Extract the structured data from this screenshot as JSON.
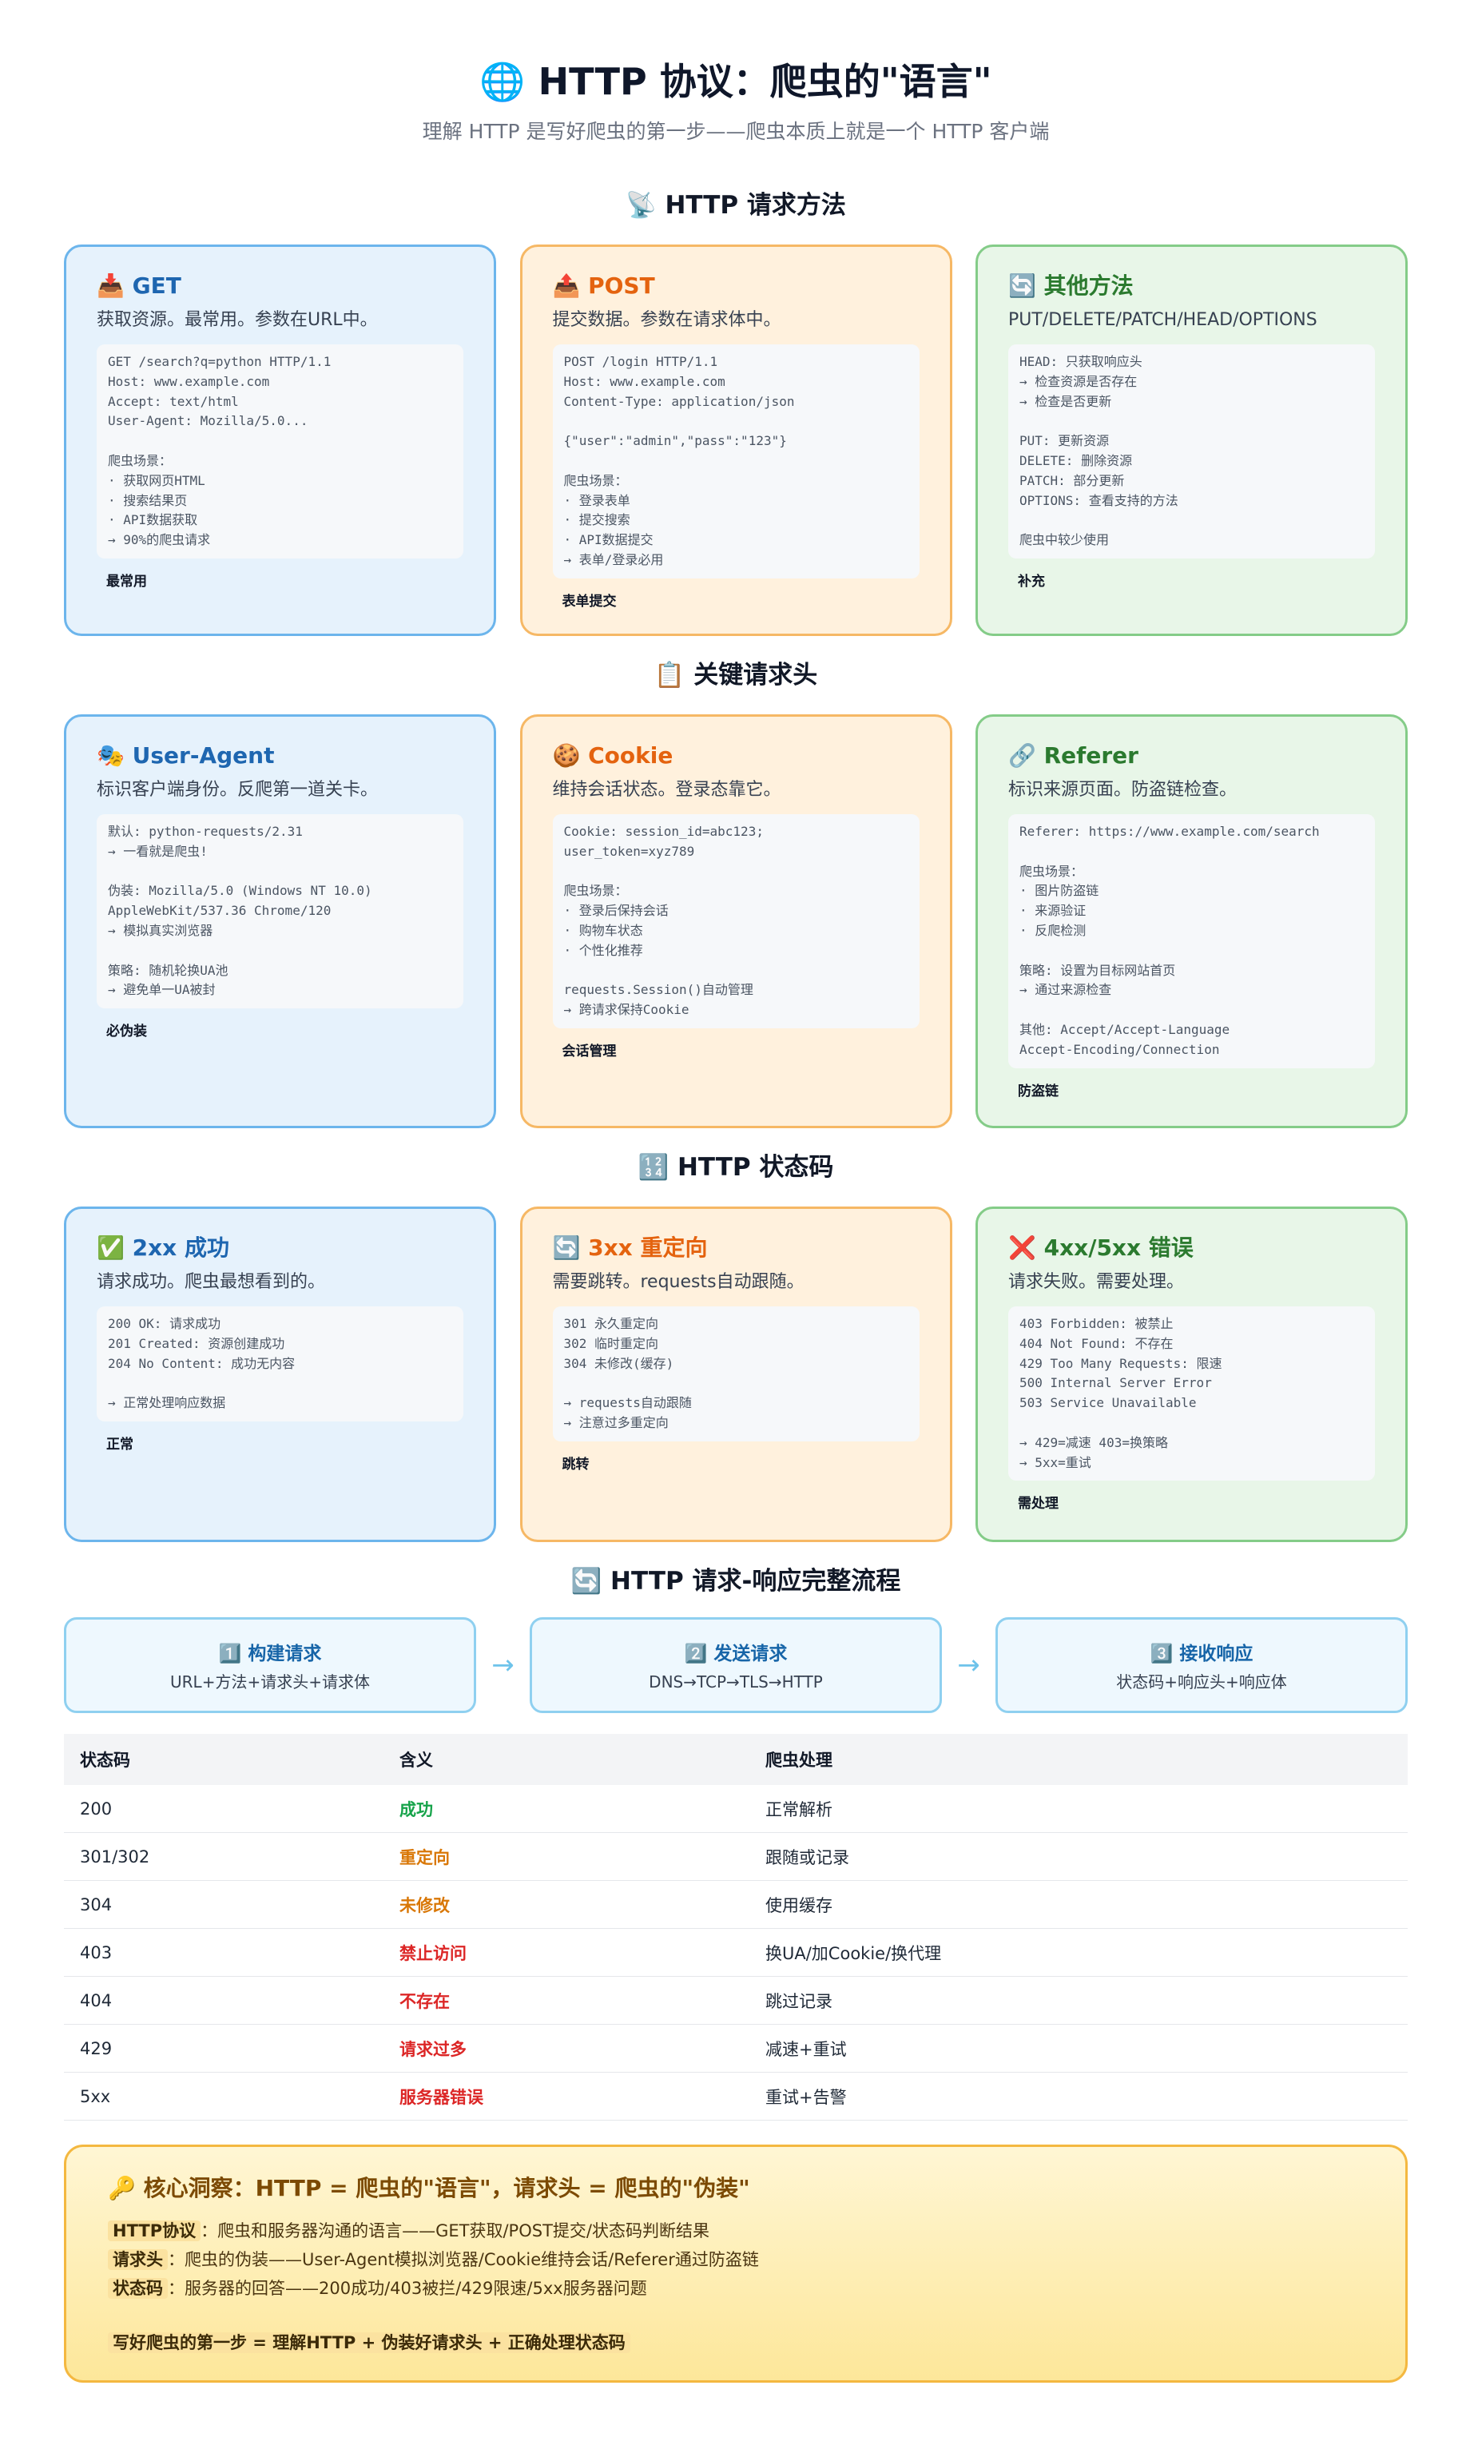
{
  "header": {
    "title": "🌐 HTTP 协议：爬虫的\"语言\"",
    "subtitle": "理解 HTTP 是写好爬虫的第一步——爬虫本质上就是一个 HTTP 客户端"
  },
  "methods": {
    "section_title": "📡 HTTP 请求方法",
    "cards": [
      {
        "title": "📥 GET",
        "desc": "获取资源。最常用。参数在URL中。",
        "code": "GET /search?q=python HTTP/1.1\nHost: www.example.com\nAccept: text/html\nUser-Agent: Mozilla/5.0...\n\n爬虫场景：\n· 获取网页HTML\n· 搜索结果页\n· API数据获取\n→ 90%的爬虫请求",
        "tag": "最常用"
      },
      {
        "title": "📤 POST",
        "desc": "提交数据。参数在请求体中。",
        "code": "POST /login HTTP/1.1\nHost: www.example.com\nContent-Type: application/json\n\n{\"user\":\"admin\",\"pass\":\"123\"}\n\n爬虫场景：\n· 登录表单\n· 提交搜索\n· API数据提交\n→ 表单/登录必用",
        "tag": "表单提交"
      },
      {
        "title": "🔄 其他方法",
        "desc": "PUT/DELETE/PATCH/HEAD/OPTIONS",
        "code": "HEAD: 只获取响应头\n→ 检查资源是否存在\n→ 检查是否更新\n\nPUT: 更新资源\nDELETE: 删除资源\nPATCH: 部分更新\nOPTIONS: 查看支持的方法\n\n爬虫中较少使用",
        "tag": "补充"
      }
    ]
  },
  "headers": {
    "section_title": "📋 关键请求头",
    "cards": [
      {
        "title": "🎭 User-Agent",
        "desc": "标识客户端身份。反爬第一道关卡。",
        "code": "默认: python-requests/2.31\n→ 一看就是爬虫!\n\n伪装: Mozilla/5.0 (Windows NT 10.0)\nAppleWebKit/537.36 Chrome/120\n→ 模拟真实浏览器\n\n策略: 随机轮换UA池\n→ 避免单一UA被封",
        "tag": "必伪装"
      },
      {
        "title": "🍪 Cookie",
        "desc": "维持会话状态。登录态靠它。",
        "code": "Cookie: session_id=abc123;\nuser_token=xyz789\n\n爬虫场景：\n· 登录后保持会话\n· 购物车状态\n· 个性化推荐\n\nrequests.Session()自动管理\n→ 跨请求保持Cookie",
        "tag": "会话管理"
      },
      {
        "title": "🔗 Referer",
        "desc": "标识来源页面。防盗链检查。",
        "code": "Referer: https://www.example.com/search\n\n爬虫场景：\n· 图片防盗链\n· 来源验证\n· 反爬检测\n\n策略: 设置为目标网站首页\n→ 通过来源检查\n\n其他: Accept/Accept-Language\nAccept-Encoding/Connection",
        "tag": "防盗链"
      }
    ]
  },
  "status_codes": {
    "section_title": "🔢 HTTP 状态码",
    "cards": [
      {
        "title": "✅ 2xx 成功",
        "desc": "请求成功。爬虫最想看到的。",
        "code": "200 OK: 请求成功\n201 Created: 资源创建成功\n204 No Content: 成功无内容\n\n→ 正常处理响应数据",
        "tag": "正常"
      },
      {
        "title": "🔄 3xx 重定向",
        "desc": "需要跳转。requests自动跟随。",
        "code": "301 永久重定向\n302 临时重定向\n304 未修改(缓存)\n\n→ requests自动跟随\n→ 注意过多重定向",
        "tag": "跳转"
      },
      {
        "title": "❌ 4xx/5xx 错误",
        "desc": "请求失败。需要处理。",
        "code": "403 Forbidden: 被禁止\n404 Not Found: 不存在\n429 Too Many Requests: 限速\n500 Internal Server Error\n503 Service Unavailable\n\n→ 429=减速 403=换策略\n→ 5xx=重试",
        "tag": "需处理"
      }
    ]
  },
  "flow": {
    "section_title": "🔄 HTTP 请求-响应完整流程",
    "arrow": "→",
    "steps": [
      {
        "title": "1️⃣ 构建请求",
        "desc": "URL+方法+请求头+请求体"
      },
      {
        "title": "2️⃣ 发送请求",
        "desc": "DNS→TCP→TLS→HTTP"
      },
      {
        "title": "3️⃣ 接收响应",
        "desc": "状态码+响应头+响应体"
      }
    ]
  },
  "table": {
    "columns": [
      "状态码",
      "含义",
      "爬虫处理"
    ],
    "rows": [
      {
        "code": "200",
        "meaning": "成功",
        "action": "正常解析",
        "color": "#16a34a"
      },
      {
        "code": "301/302",
        "meaning": "重定向",
        "action": "跟随或记录",
        "color": "#d97706"
      },
      {
        "code": "304",
        "meaning": "未修改",
        "action": "使用缓存",
        "color": "#d97706"
      },
      {
        "code": "403",
        "meaning": "禁止访问",
        "action": "换UA/加Cookie/换代理",
        "color": "#dc2626"
      },
      {
        "code": "404",
        "meaning": "不存在",
        "action": "跳过记录",
        "color": "#dc2626"
      },
      {
        "code": "429",
        "meaning": "请求过多",
        "action": "减速+重试",
        "color": "#dc2626"
      },
      {
        "code": "5xx",
        "meaning": "服务器错误",
        "action": "重试+告警",
        "color": "#dc2626"
      }
    ]
  },
  "insight": {
    "title": "🔑 核心洞察：HTTP = 爬虫的\"语言\"，请求头 = 爬虫的\"伪装\"",
    "lines": [
      {
        "key": "HTTP协议",
        "text": "：爬虫和服务器沟通的语言——GET获取/POST提交/状态码判断结果"
      },
      {
        "key": "请求头",
        "text": "：爬虫的伪装——User-Agent模拟浏览器/Cookie维持会话/Referer通过防盗链"
      },
      {
        "key": "状态码",
        "text": "：服务器的回答——200成功/403被拦/429限速/5xx服务器问题"
      }
    ],
    "final": "写好爬虫的第一步 = 理解HTTP + 伪装好请求头 + 正确处理状态码"
  }
}
